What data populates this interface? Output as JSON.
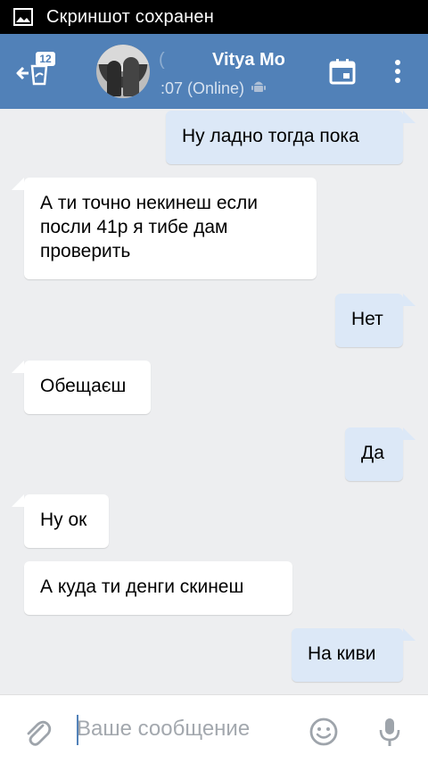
{
  "status_bar": {
    "notification": "Скриншот сохранен",
    "icon": "image-icon"
  },
  "header": {
    "unread_count": "12",
    "contact_name": "Vitya Mo",
    "name_prefix": "(",
    "status": ":07 (Online)",
    "platform_icon": "android-icon",
    "accent_color": "#5181b8"
  },
  "messages": [
    {
      "dir": "out",
      "text": "Ну ладно тогда пока"
    },
    {
      "dir": "in",
      "text": "А ти точно некинеш если посли 41р я тибе дам проверить"
    },
    {
      "dir": "out",
      "text": "Нет"
    },
    {
      "dir": "in",
      "text": "Обещаєш"
    },
    {
      "dir": "out",
      "text": "Да"
    },
    {
      "dir": "in",
      "text": "Ну ок"
    },
    {
      "dir": "in",
      "text": "А куда ти денги скинеш"
    },
    {
      "dir": "out",
      "text": "На киви"
    }
  ],
  "composer": {
    "placeholder": "Ваше сообщение",
    "value": ""
  }
}
